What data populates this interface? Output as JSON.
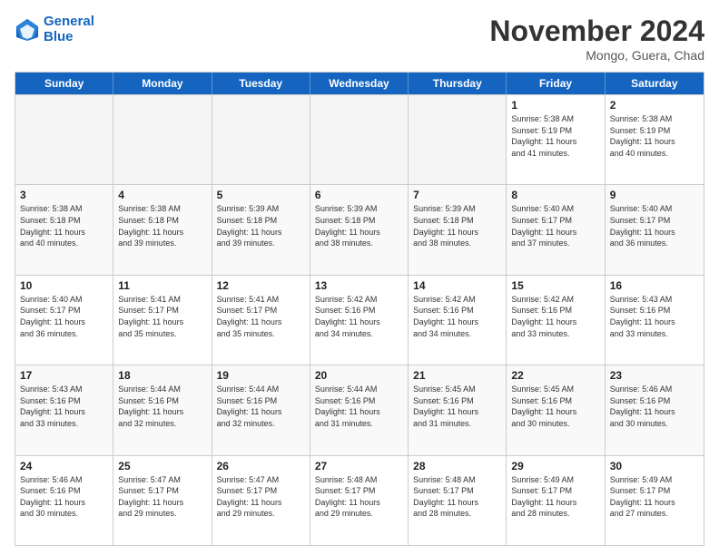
{
  "logo": {
    "line1": "General",
    "line2": "Blue"
  },
  "title": "November 2024",
  "location": "Mongo, Guera, Chad",
  "weekdays": [
    "Sunday",
    "Monday",
    "Tuesday",
    "Wednesday",
    "Thursday",
    "Friday",
    "Saturday"
  ],
  "rows": [
    [
      {
        "day": "",
        "info": "",
        "empty": true
      },
      {
        "day": "",
        "info": "",
        "empty": true
      },
      {
        "day": "",
        "info": "",
        "empty": true
      },
      {
        "day": "",
        "info": "",
        "empty": true
      },
      {
        "day": "",
        "info": "",
        "empty": true
      },
      {
        "day": "1",
        "info": "Sunrise: 5:38 AM\nSunset: 5:19 PM\nDaylight: 11 hours\nand 41 minutes.",
        "empty": false
      },
      {
        "day": "2",
        "info": "Sunrise: 5:38 AM\nSunset: 5:19 PM\nDaylight: 11 hours\nand 40 minutes.",
        "empty": false
      }
    ],
    [
      {
        "day": "3",
        "info": "Sunrise: 5:38 AM\nSunset: 5:18 PM\nDaylight: 11 hours\nand 40 minutes.",
        "empty": false
      },
      {
        "day": "4",
        "info": "Sunrise: 5:38 AM\nSunset: 5:18 PM\nDaylight: 11 hours\nand 39 minutes.",
        "empty": false
      },
      {
        "day": "5",
        "info": "Sunrise: 5:39 AM\nSunset: 5:18 PM\nDaylight: 11 hours\nand 39 minutes.",
        "empty": false
      },
      {
        "day": "6",
        "info": "Sunrise: 5:39 AM\nSunset: 5:18 PM\nDaylight: 11 hours\nand 38 minutes.",
        "empty": false
      },
      {
        "day": "7",
        "info": "Sunrise: 5:39 AM\nSunset: 5:18 PM\nDaylight: 11 hours\nand 38 minutes.",
        "empty": false
      },
      {
        "day": "8",
        "info": "Sunrise: 5:40 AM\nSunset: 5:17 PM\nDaylight: 11 hours\nand 37 minutes.",
        "empty": false
      },
      {
        "day": "9",
        "info": "Sunrise: 5:40 AM\nSunset: 5:17 PM\nDaylight: 11 hours\nand 36 minutes.",
        "empty": false
      }
    ],
    [
      {
        "day": "10",
        "info": "Sunrise: 5:40 AM\nSunset: 5:17 PM\nDaylight: 11 hours\nand 36 minutes.",
        "empty": false
      },
      {
        "day": "11",
        "info": "Sunrise: 5:41 AM\nSunset: 5:17 PM\nDaylight: 11 hours\nand 35 minutes.",
        "empty": false
      },
      {
        "day": "12",
        "info": "Sunrise: 5:41 AM\nSunset: 5:17 PM\nDaylight: 11 hours\nand 35 minutes.",
        "empty": false
      },
      {
        "day": "13",
        "info": "Sunrise: 5:42 AM\nSunset: 5:16 PM\nDaylight: 11 hours\nand 34 minutes.",
        "empty": false
      },
      {
        "day": "14",
        "info": "Sunrise: 5:42 AM\nSunset: 5:16 PM\nDaylight: 11 hours\nand 34 minutes.",
        "empty": false
      },
      {
        "day": "15",
        "info": "Sunrise: 5:42 AM\nSunset: 5:16 PM\nDaylight: 11 hours\nand 33 minutes.",
        "empty": false
      },
      {
        "day": "16",
        "info": "Sunrise: 5:43 AM\nSunset: 5:16 PM\nDaylight: 11 hours\nand 33 minutes.",
        "empty": false
      }
    ],
    [
      {
        "day": "17",
        "info": "Sunrise: 5:43 AM\nSunset: 5:16 PM\nDaylight: 11 hours\nand 33 minutes.",
        "empty": false
      },
      {
        "day": "18",
        "info": "Sunrise: 5:44 AM\nSunset: 5:16 PM\nDaylight: 11 hours\nand 32 minutes.",
        "empty": false
      },
      {
        "day": "19",
        "info": "Sunrise: 5:44 AM\nSunset: 5:16 PM\nDaylight: 11 hours\nand 32 minutes.",
        "empty": false
      },
      {
        "day": "20",
        "info": "Sunrise: 5:44 AM\nSunset: 5:16 PM\nDaylight: 11 hours\nand 31 minutes.",
        "empty": false
      },
      {
        "day": "21",
        "info": "Sunrise: 5:45 AM\nSunset: 5:16 PM\nDaylight: 11 hours\nand 31 minutes.",
        "empty": false
      },
      {
        "day": "22",
        "info": "Sunrise: 5:45 AM\nSunset: 5:16 PM\nDaylight: 11 hours\nand 30 minutes.",
        "empty": false
      },
      {
        "day": "23",
        "info": "Sunrise: 5:46 AM\nSunset: 5:16 PM\nDaylight: 11 hours\nand 30 minutes.",
        "empty": false
      }
    ],
    [
      {
        "day": "24",
        "info": "Sunrise: 5:46 AM\nSunset: 5:16 PM\nDaylight: 11 hours\nand 30 minutes.",
        "empty": false
      },
      {
        "day": "25",
        "info": "Sunrise: 5:47 AM\nSunset: 5:17 PM\nDaylight: 11 hours\nand 29 minutes.",
        "empty": false
      },
      {
        "day": "26",
        "info": "Sunrise: 5:47 AM\nSunset: 5:17 PM\nDaylight: 11 hours\nand 29 minutes.",
        "empty": false
      },
      {
        "day": "27",
        "info": "Sunrise: 5:48 AM\nSunset: 5:17 PM\nDaylight: 11 hours\nand 29 minutes.",
        "empty": false
      },
      {
        "day": "28",
        "info": "Sunrise: 5:48 AM\nSunset: 5:17 PM\nDaylight: 11 hours\nand 28 minutes.",
        "empty": false
      },
      {
        "day": "29",
        "info": "Sunrise: 5:49 AM\nSunset: 5:17 PM\nDaylight: 11 hours\nand 28 minutes.",
        "empty": false
      },
      {
        "day": "30",
        "info": "Sunrise: 5:49 AM\nSunset: 5:17 PM\nDaylight: 11 hours\nand 27 minutes.",
        "empty": false
      }
    ]
  ]
}
